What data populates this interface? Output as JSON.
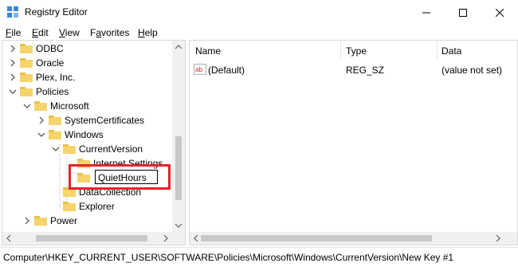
{
  "window": {
    "title": "Registry Editor"
  },
  "menu": {
    "file": {
      "u": "F",
      "rest": "ile"
    },
    "edit": {
      "u": "E",
      "rest": "dit"
    },
    "view": {
      "u": "V",
      "rest": "iew"
    },
    "favorites": {
      "pre": "F",
      "u": "a",
      "rest": "vorites"
    },
    "help": {
      "u": "H",
      "rest": "elp"
    }
  },
  "tree": {
    "items": [
      {
        "label": "ODBC",
        "expander": "collapsed"
      },
      {
        "label": "Oracle",
        "expander": "collapsed"
      },
      {
        "label": "Plex, Inc.",
        "expander": "collapsed"
      },
      {
        "label": "Policies",
        "expander": "expanded"
      },
      {
        "label": "Microsoft",
        "expander": "expanded"
      },
      {
        "label": "SystemCertificates",
        "expander": "collapsed"
      },
      {
        "label": "Windows",
        "expander": "expanded"
      },
      {
        "label": "CurrentVersion",
        "expander": "expanded"
      },
      {
        "label": "Internet Settings",
        "expander": "none"
      },
      {
        "label": "DataCollection",
        "expander": "none"
      },
      {
        "label": "Explorer",
        "expander": "none"
      },
      {
        "label": "Power",
        "expander": "collapsed"
      }
    ],
    "rename_value": "QuietHours"
  },
  "list": {
    "columns": {
      "name": "Name",
      "type": "Type",
      "data": "Data"
    },
    "rows": [
      {
        "name": "(Default)",
        "type": "REG_SZ",
        "data": "(value not set)",
        "icon": "string-value-icon"
      }
    ]
  },
  "status": {
    "path": "Computer\\HKEY_CURRENT_USER\\SOFTWARE\\Policies\\Microsoft\\Windows\\CurrentVersion\\New Key #1"
  },
  "colors": {
    "folder": "#f5d46b",
    "highlight": "#e3242b",
    "selection_text": "#000000"
  }
}
